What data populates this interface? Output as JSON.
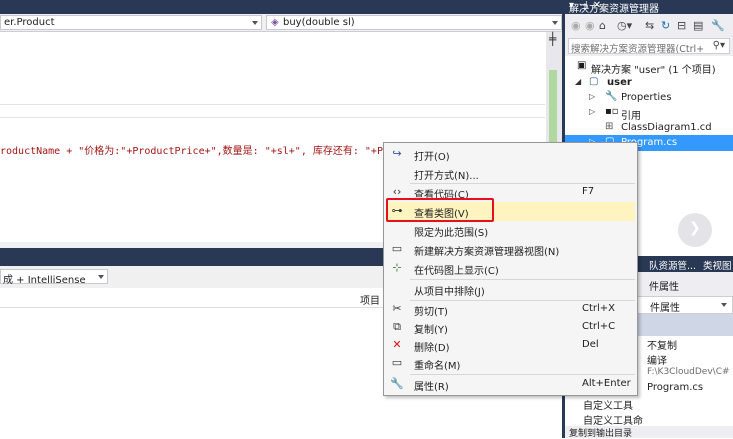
{
  "nav": {
    "left_combo": "er.Product",
    "right_combo": "buy(double sl)"
  },
  "code_line": "roductName + \"价格为:\"+ProductPrice+\",数量是: \"+sl+\", 库存还有: \"+Prod",
  "output": {
    "build_option": "成 + IntelliSense",
    "column_project": "项目"
  },
  "solution_explorer": {
    "title": "解决方案资源管理器",
    "search_placeholder": "搜索解决方案资源管理器(Ctrl+",
    "tree": [
      {
        "label": "解决方案 \"user\" (1 个项目)",
        "icon": "solution-icon"
      },
      {
        "label": "user",
        "icon": "csharp-project-icon"
      },
      {
        "label": "Properties",
        "icon": "wrench-icon"
      },
      {
        "label": "引用",
        "icon": "references-icon"
      },
      {
        "label": "ClassDiagram1.cd",
        "icon": "class-diagram-icon"
      },
      {
        "label": "Program.cs",
        "icon": "csharp-file-icon"
      }
    ],
    "tabs": [
      "队资源管...",
      "类视图"
    ]
  },
  "properties": {
    "title": "件属性",
    "rows": [
      {
        "key": "",
        "value": "不复制"
      },
      {
        "key": "",
        "value": "编译"
      },
      {
        "key": "",
        "value": "F:\\K3CloudDev\\C#"
      },
      {
        "key": "",
        "value": "Program.cs"
      },
      {
        "key": "自定义工具",
        "value": ""
      },
      {
        "key": "自定义工具命",
        "value": ""
      }
    ],
    "footer": "复制到输出目录"
  },
  "context_menu": {
    "items": [
      {
        "label": "打开(O)",
        "shortcut": "",
        "icon": "open-icon"
      },
      {
        "label": "打开方式(N)...",
        "shortcut": "",
        "icon": ""
      },
      {
        "label": "查看代码(C)",
        "shortcut": "F7",
        "icon": "code-icon"
      },
      {
        "label": "查看类图(V)",
        "shortcut": "",
        "icon": "class-diagram-icon"
      },
      {
        "label": "限定为此范围(S)",
        "shortcut": "",
        "icon": ""
      },
      {
        "label": "新建解决方案资源管理器视图(N)",
        "shortcut": "",
        "icon": "new-view-icon"
      },
      {
        "label": "在代码图上显示(C)",
        "shortcut": "",
        "icon": "code-map-icon"
      },
      {
        "label": "从项目中排除(J)",
        "shortcut": "",
        "icon": ""
      },
      {
        "label": "剪切(T)",
        "shortcut": "Ctrl+X",
        "icon": "scissors-icon"
      },
      {
        "label": "复制(Y)",
        "shortcut": "Ctrl+C",
        "icon": "copy-icon"
      },
      {
        "label": "删除(D)",
        "shortcut": "Del",
        "icon": "delete-icon"
      },
      {
        "label": "重命名(M)",
        "shortcut": "",
        "icon": "rename-icon"
      },
      {
        "label": "属性(R)",
        "shortcut": "Alt+Enter",
        "icon": "wrench-icon"
      }
    ]
  },
  "colors": {
    "accent_dark": "#293955",
    "selection": "#3399ff",
    "highlight_box": "#e8101a",
    "menu_hover": "#fdf4bf"
  }
}
